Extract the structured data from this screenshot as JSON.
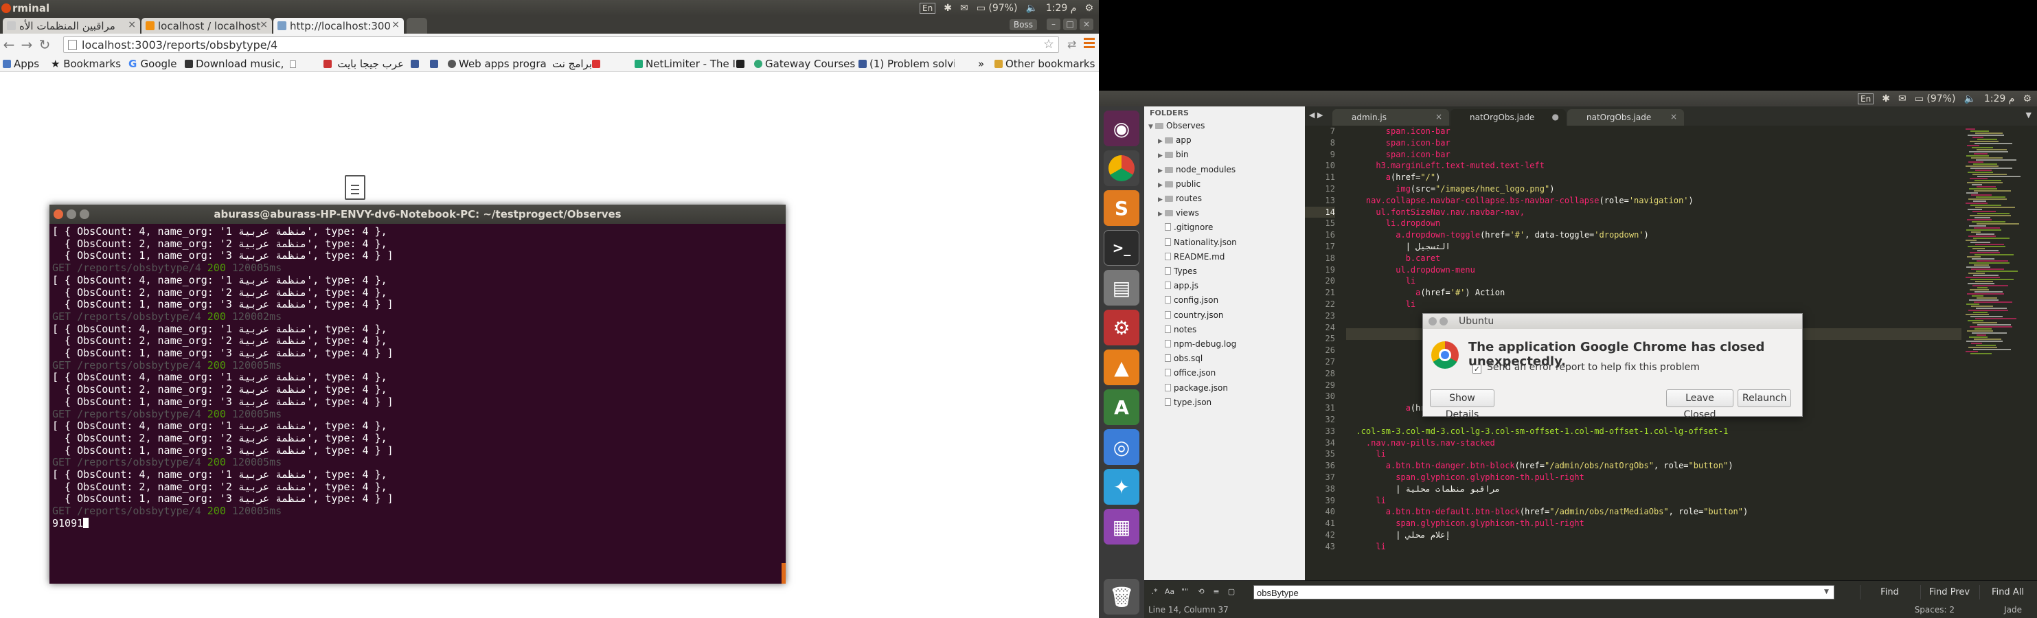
{
  "left_panel": {
    "title": "rminal",
    "indicators": {
      "keyboard": "En",
      "battery": "(97%)",
      "clock": "1:29 م"
    },
    "tabs": [
      {
        "label": "مراقبين المنظمات الأه"
      },
      {
        "label": "localhost / localhost"
      },
      {
        "label": "http://localhost:300"
      }
    ],
    "user_badge": "Boss",
    "url": "localhost:3003/reports/obsbytype/4",
    "bookmarks": [
      {
        "label": "Apps"
      },
      {
        "label": "Bookmarks"
      },
      {
        "label": "Google"
      },
      {
        "label": "Download music,"
      },
      {
        "label": "عرب جيجا بايت"
      },
      {
        "label": ""
      },
      {
        "label": ""
      },
      {
        "label": "Web apps progra"
      },
      {
        "label": "برامج نت"
      },
      {
        "label": "NetLimiter - The I"
      },
      {
        "label": ""
      },
      {
        "label": "Gateway Courses"
      },
      {
        "label": "(1) Problem solvin"
      },
      {
        "label": "»"
      },
      {
        "label": "Other bookmarks"
      }
    ],
    "terminal": {
      "title": "aburass@aburass-HP-ENVY-dv6-Notebook-PC: ~/testprogect/Observes",
      "obs_lines": [
        "[ { ObsCount: 4, name_org: 'منظمة عربية 1', type: 4 },",
        "  { ObsCount: 2, name_org: 'منظمة عربية 2', type: 4 },",
        "  { ObsCount: 1, name_org: 'منظمة عربية 3', type: 4 } ]"
      ],
      "get_lines": [
        {
          "path": "GET /reports/obsbytype/4 ",
          "status": "200",
          "time": " 120005ms"
        },
        {
          "path": "GET /reports/obsbytype/4 ",
          "status": "200",
          "time": " 120002ms"
        },
        {
          "path": "GET /reports/obsbytype/4 ",
          "status": "200",
          "time": " 120005ms"
        },
        {
          "path": "GET /reports/obsbytype/4 ",
          "status": "200",
          "time": " 120005ms"
        },
        {
          "path": "GET /reports/obsbytype/4 ",
          "status": "200",
          "time": " 120005ms"
        },
        {
          "path": "GET /reports/obsbytype/4 ",
          "status": "200",
          "time": " 120005ms"
        }
      ],
      "prompt": "91091"
    }
  },
  "right_panel": {
    "indicators": {
      "keyboard": "En",
      "battery": "(97%)",
      "clock": "1:29 م",
      "user": "Jade"
    },
    "sidebar": {
      "header": "FOLDERS",
      "root": "Observes",
      "folders": [
        "app",
        "bin",
        "node_modules",
        "public",
        "routes",
        "views"
      ],
      "files": [
        ".gitignore",
        "Nationality.json",
        "README.md",
        "Types",
        "app.js",
        "config.json",
        "country.json",
        "notes",
        "npm-debug.log",
        "obs.sql",
        "office.json",
        "package.json",
        "type.json"
      ]
    },
    "tabs": [
      {
        "label": "admin.js"
      },
      {
        "label": "natOrgObs.jade"
      },
      {
        "label": "natOrgObs.jade"
      }
    ],
    "line_numbers": [
      "7",
      "8",
      "9",
      "10",
      "11",
      "12",
      "13",
      "14",
      "15",
      "16",
      "17",
      "18",
      "19",
      "20",
      "21",
      "22",
      "23",
      "24",
      "25",
      "26",
      "27",
      "28",
      "29",
      "30",
      "31",
      "32",
      "33",
      "34",
      "35",
      "36",
      "37",
      "38",
      "39",
      "40",
      "41",
      "42",
      "43"
    ],
    "code_lines": [
      [
        {
          "c": "t",
          "x": "        span.icon-bar"
        }
      ],
      [
        {
          "c": "t",
          "x": "        span.icon-bar"
        }
      ],
      [
        {
          "c": "t",
          "x": "        span.icon-bar"
        }
      ],
      [
        {
          "c": "t",
          "x": "      h3.marginLeft.text-muted.text-left"
        }
      ],
      [
        {
          "c": "t",
          "x": "        a"
        },
        {
          "c": "",
          "x": "(href="
        },
        {
          "c": "s",
          "x": "\"/\""
        },
        {
          "c": "",
          "x": ")"
        }
      ],
      [
        {
          "c": "t",
          "x": "          img"
        },
        {
          "c": "",
          "x": "(src="
        },
        {
          "c": "s",
          "x": "\"/images/hnec_logo.png\""
        },
        {
          "c": "",
          "x": ")"
        }
      ],
      [
        {
          "c": "t",
          "x": "    nav.collapse.navbar-collapse.bs-navbar-collapse"
        },
        {
          "c": "",
          "x": "(role="
        },
        {
          "c": "s",
          "x": "'navigation'"
        },
        {
          "c": "",
          "x": ")"
        }
      ],
      [
        {
          "c": "t",
          "x": "      ul.fontSizeNav.nav.navbar-nav,"
        }
      ],
      [
        {
          "c": "t",
          "x": "        li.dropdown"
        }
      ],
      [
        {
          "c": "t",
          "x": "          a.dropdown-toggle"
        },
        {
          "c": "",
          "x": "(href="
        },
        {
          "c": "s",
          "x": "'#'"
        },
        {
          "c": "",
          "x": ", data-toggle="
        },
        {
          "c": "s",
          "x": "'dropdown'"
        },
        {
          "c": "",
          "x": ")"
        }
      ],
      [
        {
          "c": "",
          "x": "            | التسجيل"
        }
      ],
      [
        {
          "c": "t",
          "x": "            b.caret"
        }
      ],
      [
        {
          "c": "t",
          "x": "          ul.dropdown-menu"
        }
      ],
      [
        {
          "c": "t",
          "x": "            li"
        }
      ],
      [
        {
          "c": "t",
          "x": "              a"
        },
        {
          "c": "",
          "x": "(href="
        },
        {
          "c": "s",
          "x": "'#'"
        },
        {
          "c": "",
          "x": ") Action"
        }
      ],
      [
        {
          "c": "t",
          "x": "            li"
        }
      ],
      [
        {
          "c": "t",
          "x": ""
        }
      ],
      [
        {
          "c": "t",
          "x": ""
        }
      ],
      [
        {
          "c": "t",
          "x": ""
        }
      ],
      [
        {
          "c": "t",
          "x": ""
        }
      ],
      [
        {
          "c": "t",
          "x": ""
        }
      ],
      [
        {
          "c": "t",
          "x": ""
        }
      ],
      [
        {
          "c": "t",
          "x": ""
        }
      ],
      [
        {
          "c": "t",
          "x": ""
        }
      ],
      [
        {
          "c": "t",
          "x": "            a"
        },
        {
          "c": "",
          "x": "(href="
        },
        {
          "c": "s",
          "x": "'/admin/org'"
        },
        {
          "c": "",
          "x": ") المنظمات"
        }
      ],
      [
        {
          "c": "",
          "x": ""
        }
      ],
      [
        {
          "c": "a",
          "x": "  .col-sm-3.col-md-3.col-lg-3.col-sm-offset-1.col-md-offset-1.col-lg-offset-1"
        }
      ],
      [
        {
          "c": "t",
          "x": "    .nav.nav-pills.nav-stacked"
        }
      ],
      [
        {
          "c": "t",
          "x": "      li"
        }
      ],
      [
        {
          "c": "t",
          "x": "        a.btn.btn-danger.btn-block"
        },
        {
          "c": "",
          "x": "(href="
        },
        {
          "c": "s",
          "x": "\"/admin/obs/natOrgObs\""
        },
        {
          "c": "",
          "x": ", role="
        },
        {
          "c": "s",
          "x": "\"button\""
        },
        {
          "c": "",
          "x": ")"
        }
      ],
      [
        {
          "c": "t",
          "x": "          span.glyphicon.glyphicon-th.pull-right"
        }
      ],
      [
        {
          "c": "",
          "x": "          | مراقبو منظمات محلية"
        }
      ],
      [
        {
          "c": "t",
          "x": "      li"
        }
      ],
      [
        {
          "c": "t",
          "x": "        a.btn.btn-default.btn-block"
        },
        {
          "c": "",
          "x": "(href="
        },
        {
          "c": "s",
          "x": "\"/admin/obs/natMediaObs\""
        },
        {
          "c": "",
          "x": ", role="
        },
        {
          "c": "s",
          "x": "\"button\""
        },
        {
          "c": "",
          "x": ")"
        }
      ],
      [
        {
          "c": "t",
          "x": "          span.glyphicon.glyphicon-th.pull-right"
        }
      ],
      [
        {
          "c": "",
          "x": "          | إعلام محلي"
        }
      ],
      [
        {
          "c": "t",
          "x": "      li"
        }
      ]
    ],
    "dialog": {
      "title": "Ubuntu",
      "message": "The application Google Chrome has closed unexpectedly.",
      "checkbox_label": "Send an error report to help fix this problem",
      "show_details": "Show Details",
      "leave_closed": "Leave Closed",
      "relaunch": "Relaunch"
    },
    "find": {
      "value": "obsBytype",
      "find_label": "Find",
      "find_prev_label": "Find Prev",
      "find_all_label": "Find All"
    },
    "status": {
      "position": "Line 14, Column 37",
      "spaces": "Spaces: 2",
      "syntax": "Jade"
    }
  }
}
